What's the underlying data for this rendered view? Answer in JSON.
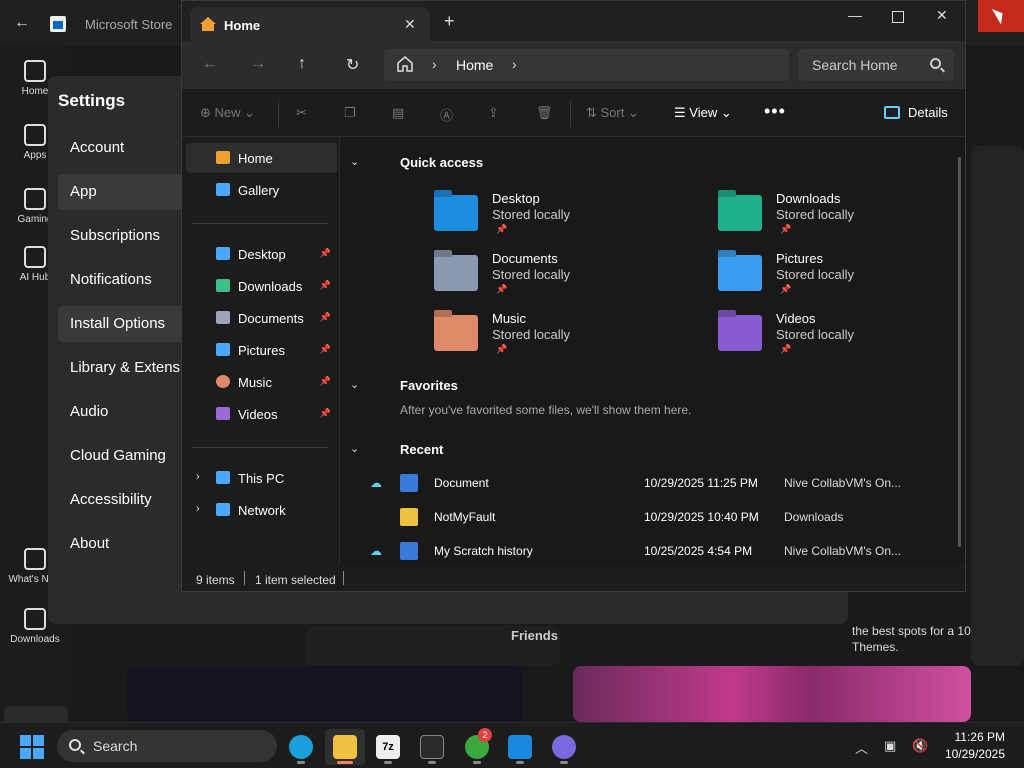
{
  "store": {
    "title": "Microsoft Store",
    "rail": [
      {
        "label": "Home"
      },
      {
        "label": "Apps"
      },
      {
        "label": "Gaming"
      },
      {
        "label": "AI Hub"
      },
      {
        "label": "What's New"
      },
      {
        "label": "Downloads"
      }
    ],
    "promo_text": "the best spots for a 10 Themes.",
    "friends_label": "Friends"
  },
  "settings": {
    "title": "Settings",
    "items": [
      {
        "label": "Account"
      },
      {
        "label": "App",
        "selected": true
      },
      {
        "label": "Subscriptions"
      },
      {
        "label": "Notifications"
      },
      {
        "label": "Install Options",
        "selected": true
      },
      {
        "label": "Library & Extensions"
      },
      {
        "label": "Audio"
      },
      {
        "label": "Cloud Gaming"
      },
      {
        "label": "Accessibility"
      },
      {
        "label": "About"
      }
    ]
  },
  "explorer": {
    "tab_title": "Home",
    "new_tab_icon": "plus-icon",
    "address": {
      "segment": "Home"
    },
    "search_placeholder": "Search Home",
    "toolbar": {
      "new_label": "New",
      "sort_label": "Sort",
      "view_label": "View",
      "details_label": "Details"
    },
    "sidebar": {
      "items": [
        {
          "label": "Home",
          "icon": "home-icon",
          "color": "#f0a030",
          "selected": true
        },
        {
          "label": "Gallery",
          "icon": "gallery-icon",
          "color": "#4aa8ff"
        },
        {
          "label": "Desktop",
          "icon": "desktop-icon",
          "color": "#4aa8ff",
          "pinned": true
        },
        {
          "label": "Downloads",
          "icon": "downloads-icon",
          "color": "#3cc08a",
          "pinned": true
        },
        {
          "label": "Documents",
          "icon": "documents-icon",
          "color": "#9aa6b8",
          "pinned": true
        },
        {
          "label": "Pictures",
          "icon": "pictures-icon",
          "color": "#4aa8ff",
          "pinned": true
        },
        {
          "label": "Music",
          "icon": "music-icon",
          "color": "#e08a6a",
          "pinned": true
        },
        {
          "label": "Videos",
          "icon": "videos-icon",
          "color": "#9a6ad8",
          "pinned": true
        },
        {
          "label": "This PC",
          "icon": "this-pc-icon",
          "color": "#4aa8ff"
        },
        {
          "label": "Network",
          "icon": "network-icon",
          "color": "#4aa8ff"
        }
      ]
    },
    "quick_access": {
      "title": "Quick access",
      "items": [
        {
          "name": "Desktop",
          "sub": "Stored locally",
          "color": "#1e8de0"
        },
        {
          "name": "Downloads",
          "sub": "Stored locally",
          "color": "#1fb08a"
        },
        {
          "name": "Documents",
          "sub": "Stored locally",
          "color": "#8a9ab0"
        },
        {
          "name": "Pictures",
          "sub": "Stored locally",
          "color": "#3a9ef0"
        },
        {
          "name": "Music",
          "sub": "Stored locally",
          "color": "#e08a6a"
        },
        {
          "name": "Videos",
          "sub": "Stored locally",
          "color": "#8a5ad0"
        }
      ]
    },
    "favorites": {
      "title": "Favorites",
      "empty_text": "After you've favorited some files, we'll show them here."
    },
    "recent": {
      "title": "Recent",
      "rows": [
        {
          "name": "Document",
          "date": "10/29/2025 11:25 PM",
          "location": "Nive CollabVM's On...",
          "cloud": true,
          "icon_color": "#3a7ad8"
        },
        {
          "name": "NotMyFault",
          "date": "10/29/2025 10:40 PM",
          "location": "Downloads",
          "cloud": false,
          "icon_color": "#f0c040"
        },
        {
          "name": "My Scratch history",
          "date": "10/25/2025 4:54 PM",
          "location": "Nive CollabVM's On...",
          "cloud": true,
          "icon_color": "#3a7ad8"
        }
      ]
    },
    "status": {
      "items": "9 items",
      "selected": "1 item selected"
    }
  },
  "taskbar": {
    "search_label": "Search",
    "badge_count": "2",
    "apps": [
      {
        "name": "edge",
        "color": "#1aa0d8"
      },
      {
        "name": "file-explorer",
        "color": "#f0c040",
        "active": true
      },
      {
        "name": "7zip",
        "color": "#eeeeee"
      },
      {
        "name": "terminal",
        "color": "#2a2a2a"
      },
      {
        "name": "xbox",
        "color": "#3ca83c"
      },
      {
        "name": "store",
        "color": "#1a8ae0"
      },
      {
        "name": "teams",
        "color": "#7a6ae0"
      }
    ],
    "time": "11:26 PM",
    "date": "10/29/2025"
  }
}
